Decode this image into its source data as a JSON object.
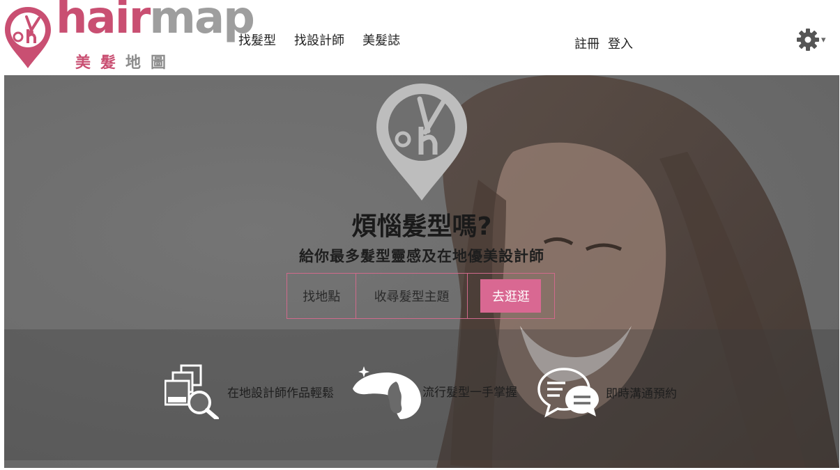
{
  "brand": {
    "name_part1": "hair",
    "name_part2": "map",
    "subtitle_part1": "美髮",
    "subtitle_part2": "地圖",
    "pink": "#c94f72",
    "gray": "#9e9e9e"
  },
  "nav": {
    "items": [
      {
        "label": "找髮型"
      },
      {
        "label": "找設計師"
      },
      {
        "label": "美髮誌"
      }
    ]
  },
  "auth": {
    "register_label": "註冊",
    "login_label": "登入"
  },
  "settings": {
    "icon": "gear-icon",
    "caret": "▾"
  },
  "hero": {
    "title": "煩惱髮型嗎?",
    "subtitle": "給你最多髮型靈感及在地優美設計師",
    "search": {
      "location_placeholder": "找地點",
      "topic_placeholder": "收尋髮型主題",
      "go_label": "去逛逛"
    },
    "features": [
      {
        "icon": "gallery-search-icon",
        "label": "在地設計師作品輕鬆"
      },
      {
        "icon": "hair-profile-icon",
        "label": "流行髮型一手掌握"
      },
      {
        "icon": "chat-bubbles-icon",
        "label": "即時溝通預約"
      }
    ]
  },
  "colors": {
    "accent": "#d96892",
    "border": "#d06a8b"
  }
}
